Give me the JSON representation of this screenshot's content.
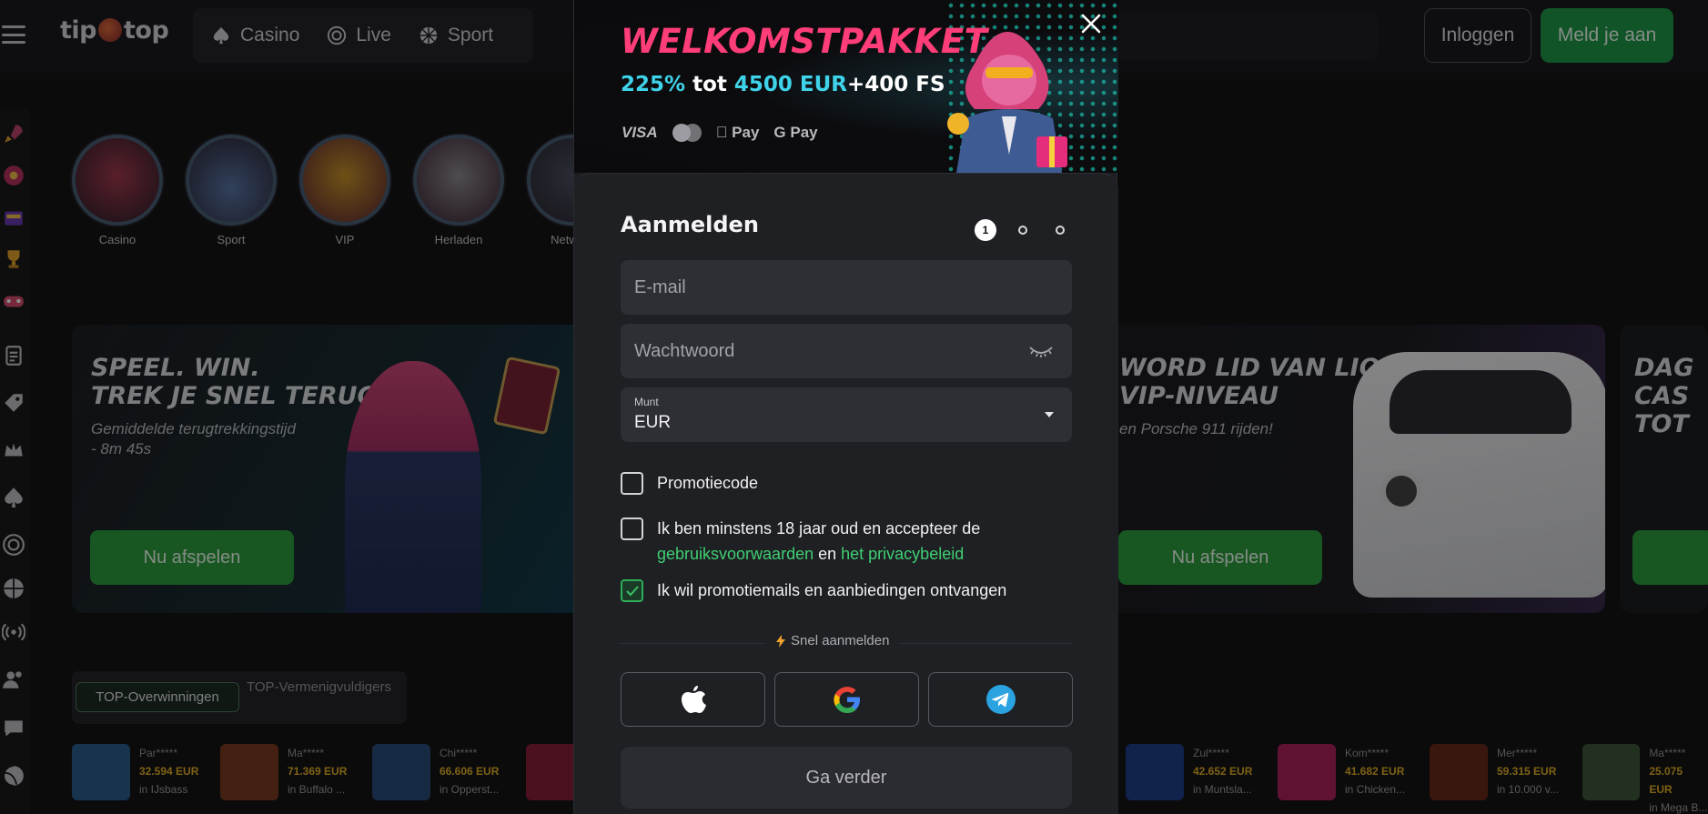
{
  "header": {
    "logo_left": "tip",
    "logo_right": "top",
    "nav": [
      {
        "label": "Casino",
        "icon": "spade-icon"
      },
      {
        "label": "Live",
        "icon": "live-chip-icon"
      },
      {
        "label": "Sport",
        "icon": "ball-icon"
      }
    ],
    "login_label": "Inloggen",
    "signup_label": "Meld je aan"
  },
  "categories": [
    {
      "label": "Casino"
    },
    {
      "label": "Sport"
    },
    {
      "label": "VIP"
    },
    {
      "label": "Herladen"
    },
    {
      "label": "Netwerk"
    }
  ],
  "banners": [
    {
      "title_line1": "SPEEL. WIN.",
      "title_line2": "TREK JE SNEL TERUG.",
      "subtitle_line1": "Gemiddelde terugtrekkingstijd",
      "subtitle_line2": "- 8m 45s",
      "button": "Nu afspelen"
    },
    {
      "title_line1": "WORD LID VAN LION KING",
      "title_line2": "VIP-NIVEAU",
      "subtitle": "en Porsche 911 rijden!",
      "button": "Nu afspelen"
    },
    {
      "title_line1": "DAG",
      "title_line2": "CAS",
      "title_line3": "TOT"
    }
  ],
  "wins_tabs": {
    "active": "TOP-Overwinningen",
    "other": "TOP-Vermenigvuldigers"
  },
  "wins": [
    {
      "user": "Par*****",
      "amount": "32.594 EUR",
      "game": "in IJsbass",
      "thumb_color": "#2b5f8f"
    },
    {
      "user": "Ma*****",
      "amount": "71.369 EUR",
      "game": "in Buffalo ...",
      "thumb_color": "#7a3b1f"
    },
    {
      "user": "Chi*****",
      "amount": "66.606 EUR",
      "game": "in Opperst...",
      "thumb_color": "#2a4e7a"
    },
    {
      "user": "Zul*****",
      "amount": "42.652 EUR",
      "game": "in Muntsla...",
      "thumb_color": "#1f3f8a"
    },
    {
      "user": "Kom*****",
      "amount": "41.682 EUR",
      "game": "in Chicken...",
      "thumb_color": "#b0225e"
    },
    {
      "user": "Mer*****",
      "amount": "59.315 EUR",
      "game": "in 10.000 v...",
      "thumb_color": "#6b2a1a"
    },
    {
      "user": "Ma*****",
      "amount": "25.075 EUR",
      "game": "in Mega B...",
      "thumb_color": "#3e5a3a"
    }
  ],
  "modal": {
    "promo_title": "WELKOMSTPAKKET",
    "promo_pct": "225%",
    "promo_mid": " tot ",
    "promo_amount": "4500 EUR",
    "promo_plus": "+400 FS",
    "pay_visa": "VISA",
    "pay_apple": " Pay",
    "pay_google": "G Pay",
    "title": "Aanmelden",
    "step_current": "1",
    "email_placeholder": "E-mail",
    "password_placeholder": "Wachtwoord",
    "currency_label": "Munt",
    "currency_value": "EUR",
    "promo_code_label": "Promotiecode",
    "terms_text": "Ik ben minstens 18 jaar oud en accepteer de",
    "terms_link": "gebruiksvoorwaarden",
    "terms_and": " en ",
    "privacy_link": "het privacybeleid",
    "marketing_label": "Ik wil promotiemails en aanbiedingen ontvangen",
    "marketing_checked": true,
    "quick_signup": "Snel aanmelden",
    "social": [
      "apple-icon",
      "google-icon",
      "telegram-icon"
    ],
    "continue_label": "Ga verder"
  },
  "colors": {
    "accent_green": "#1f9a48",
    "promo_pink": "#ff3d78",
    "promo_cyan": "#3fd3ea",
    "win_amount": "#e8b327"
  }
}
